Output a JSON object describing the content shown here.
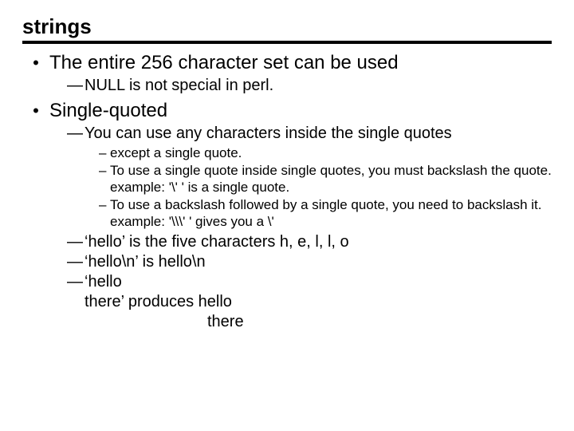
{
  "title": "strings",
  "b1": {
    "text": "The entire 256 character set can be used",
    "sub": "NULL is not special in perl."
  },
  "b2": {
    "text": "Single-quoted",
    "sub": "You can use any characters inside the single quotes",
    "l3a": "except a single quote.",
    "l3b": "To use a single quote inside single quotes, you must backslash the quote. example: '\\' '  is a single quote.",
    "l3c": "To use a backslash followed by a single quote, you need to backslash it. example:  '\\\\\\' ' gives you a \\'",
    "ex1": "‘hello’ is the five characters h, e, l, l, o",
    "ex2": "‘hello\\n’ is hello\\n",
    "ex3a": "‘hello",
    "ex3b": "there’     produces hello",
    "ex3c": "there"
  },
  "glyph": {
    "bullet": "•",
    "emdash": "—",
    "endash": "–"
  }
}
